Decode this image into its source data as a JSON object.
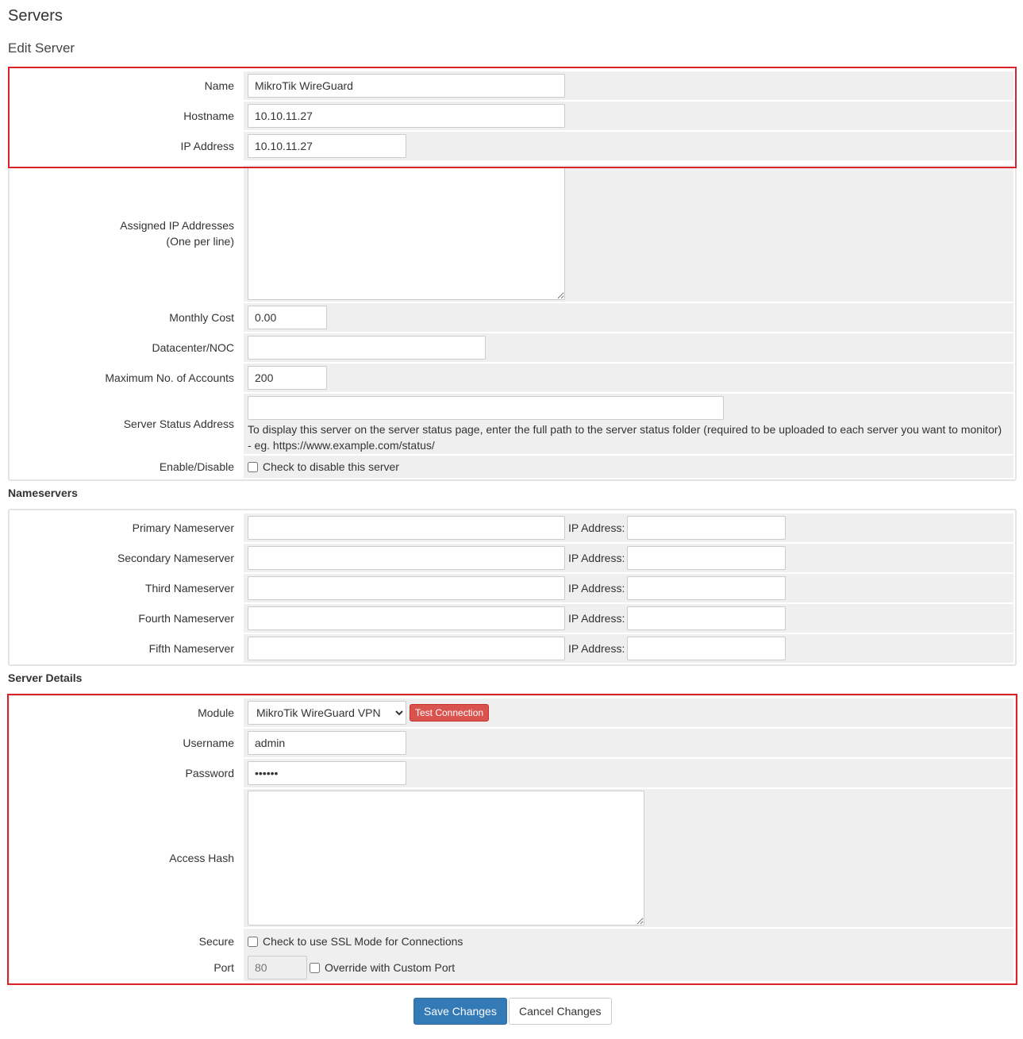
{
  "page": {
    "title": "Servers",
    "subtitle": "Edit Server"
  },
  "general": {
    "name_label": "Name",
    "name_value": "MikroTik WireGuard",
    "hostname_label": "Hostname",
    "hostname_value": "10.10.11.27",
    "ip_label": "IP Address",
    "ip_value": "10.10.11.27",
    "assigned_label_1": "Assigned IP Addresses",
    "assigned_label_2": "(One per line)",
    "assigned_value": "",
    "cost_label": "Monthly Cost",
    "cost_value": "0.00",
    "dc_label": "Datacenter/NOC",
    "dc_value": "",
    "max_label": "Maximum No. of Accounts",
    "max_value": "200",
    "status_label": "Server Status Address",
    "status_value": "",
    "status_help": "To display this server on the server status page, enter the full path to the server status folder (required to be uploaded to each server you want to monitor) - eg. https://www.example.com/status/",
    "enable_label": "Enable/Disable",
    "enable_check_label": "Check to disable this server"
  },
  "nameservers": {
    "title": "Nameservers",
    "ip_label": "IP Address:",
    "items": [
      {
        "label": "Primary Nameserver",
        "value": "",
        "ip": ""
      },
      {
        "label": "Secondary Nameserver",
        "value": "",
        "ip": ""
      },
      {
        "label": "Third Nameserver",
        "value": "",
        "ip": ""
      },
      {
        "label": "Fourth Nameserver",
        "value": "",
        "ip": ""
      },
      {
        "label": "Fifth Nameserver",
        "value": "",
        "ip": ""
      }
    ]
  },
  "details": {
    "title": "Server Details",
    "module_label": "Module",
    "module_value": "MikroTik WireGuard VPN",
    "test_button": "Test Connection",
    "username_label": "Username",
    "username_value": "admin",
    "password_label": "Password",
    "password_value": "••••••",
    "hash_label": "Access Hash",
    "hash_value": "",
    "secure_label": "Secure",
    "secure_check_label": "Check to use SSL Mode for Connections",
    "port_label": "Port",
    "port_value": "80",
    "port_check_label": "Override with Custom Port"
  },
  "actions": {
    "save": "Save Changes",
    "cancel": "Cancel Changes"
  },
  "colors": {
    "highlight": "#d9222a",
    "field_bg": "#efefef",
    "primary": "#337ab7",
    "danger": "#d9534f"
  }
}
